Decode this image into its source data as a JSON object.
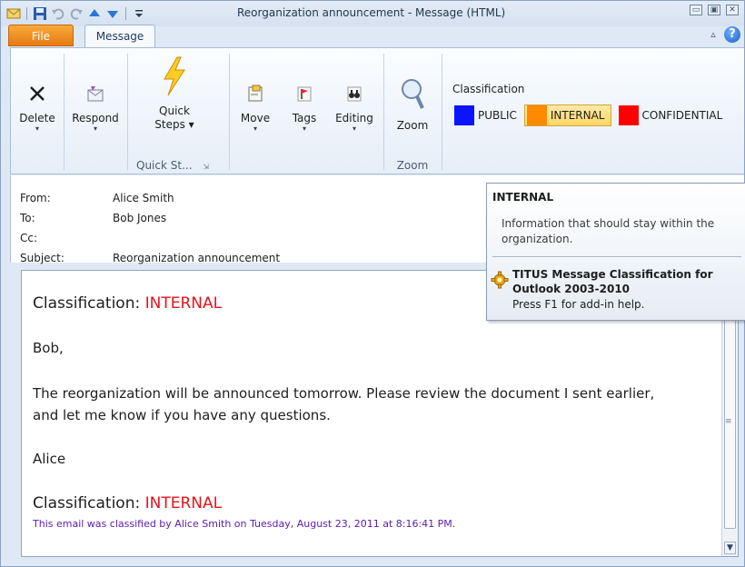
{
  "window": {
    "title": "Reorganization announcement - Message (HTML)",
    "controls": {
      "minimize": "▭",
      "restore": "▣",
      "close": "✕"
    }
  },
  "tabs": {
    "file": "File",
    "message": "Message"
  },
  "ribbon": {
    "delete": {
      "label": "Delete"
    },
    "respond": {
      "label": "Respond"
    },
    "quick_steps": {
      "label_line1": "Quick",
      "label_line2": "Steps"
    },
    "quick_steps_group": "Quick St...",
    "move": {
      "label": "Move"
    },
    "tags": {
      "label": "Tags"
    },
    "editing": {
      "label": "Editing"
    },
    "zoom": {
      "label": "Zoom"
    },
    "zoom_group": "Zoom",
    "classification": {
      "title": "Classification",
      "items": [
        {
          "label": "PUBLIC",
          "color": "#0a14ff"
        },
        {
          "label": "INTERNAL",
          "color": "#ff8a00"
        },
        {
          "label": "CONFIDENTIAL",
          "color": "#ff0000"
        }
      ],
      "active_index": 1
    }
  },
  "header": {
    "from_label": "From:",
    "from_value": "Alice Smith",
    "to_label": "To:",
    "to_value": "Bob Jones",
    "cc_label": "Cc:",
    "subject_label": "Subject:",
    "subject_value": "Reorganization announcement"
  },
  "message": {
    "classification_prefix": "Classification: ",
    "classification_value": "INTERNAL",
    "greeting": "Bob,",
    "line1": "The reorganization will be announced tomorrow. Please review the document I sent earlier,",
    "line2": "and let me know if you have any questions.",
    "signoff": "Alice",
    "footer": "This email was classified by Alice Smith on Tuesday, August 23, 2011 at 8:16:41 PM."
  },
  "tooltip": {
    "title": "INTERNAL",
    "description": "Information that should stay within the organization.",
    "addin_line1": "TITUS Message Classification for",
    "addin_line2": "Outlook 2003-2010",
    "help": "Press F1 for add-in help."
  }
}
